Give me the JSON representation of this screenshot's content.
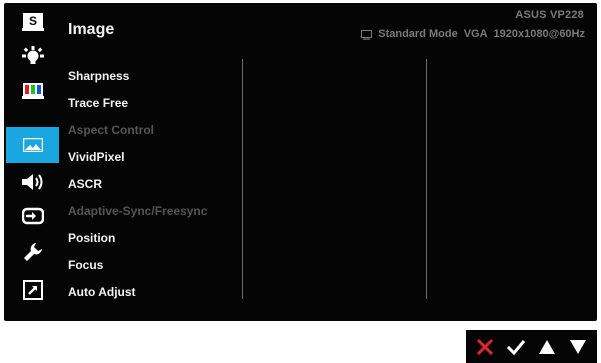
{
  "header": {
    "title": "Image",
    "brand_model": "ASUS  VP228",
    "mode": "Standard Mode",
    "input": "VGA",
    "resolution": "1920x1080@60Hz"
  },
  "sidebar": {
    "items": [
      {
        "icon": "splendid-icon",
        "label": "S"
      },
      {
        "icon": "blue-light-filter-icon"
      },
      {
        "icon": "color-icon"
      },
      {
        "icon": "image-icon",
        "active": true
      },
      {
        "icon": "sound-icon"
      },
      {
        "icon": "input-select-icon"
      },
      {
        "icon": "system-setup-icon"
      },
      {
        "icon": "shortcut-icon"
      }
    ]
  },
  "menu": {
    "items": [
      {
        "label": "Sharpness",
        "enabled": true
      },
      {
        "label": "Trace Free",
        "enabled": true
      },
      {
        "label": "Aspect Control",
        "enabled": false
      },
      {
        "label": "VividPixel",
        "enabled": true
      },
      {
        "label": "ASCR",
        "enabled": true
      },
      {
        "label": "Adaptive-Sync/Freesync",
        "enabled": false
      },
      {
        "label": "Position",
        "enabled": true
      },
      {
        "label": "Focus",
        "enabled": true
      },
      {
        "label": "Auto Adjust",
        "enabled": true
      }
    ]
  },
  "nav_buttons": [
    {
      "icon": "close-icon",
      "color": "#e0282b"
    },
    {
      "icon": "checkmark-icon",
      "color": "#ffffff"
    },
    {
      "icon": "up-arrow-icon",
      "color": "#ffffff"
    },
    {
      "icon": "down-arrow-icon",
      "color": "#ffffff"
    }
  ],
  "colors": {
    "accent": "#1aa7e0",
    "background": "#050505",
    "text": "#f2f2f2",
    "disabled_text": "#555555",
    "muted_text": "#7a7a7a"
  }
}
